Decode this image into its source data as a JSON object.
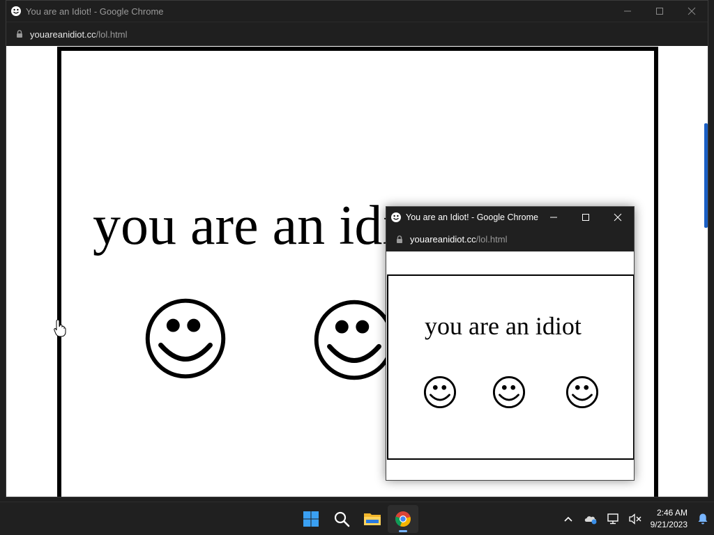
{
  "main_window": {
    "title": "You are an Idiot! - Google Chrome",
    "url_host": "youareanidiot.cc",
    "url_path": "/lol.html",
    "page_text": "you are an idiot"
  },
  "popup_window": {
    "title": "You are an Idiot! - Google Chrome",
    "url_host": "youareanidiot.cc",
    "url_path": "/lol.html",
    "page_text": "you are an idiot"
  },
  "icons": {
    "favicon": "smiley-icon",
    "lock": "lock-icon",
    "minimize": "minimize-icon",
    "maximize": "maximize-icon",
    "close": "close-icon"
  },
  "taskbar": {
    "apps": [
      "start-icon",
      "search-icon",
      "file-explorer-icon",
      "chrome-icon"
    ],
    "tray": [
      "chevron-up-icon",
      "onedrive-icon",
      "network-icon",
      "volume-muted-icon",
      "notification-bell-icon"
    ],
    "time": "2:46 AM",
    "date": "9/21/2023"
  },
  "colors": {
    "titlebar": "#1f1f1f",
    "page_bg": "#ffffff",
    "text": "#000000",
    "accent": "#78b5ff"
  }
}
